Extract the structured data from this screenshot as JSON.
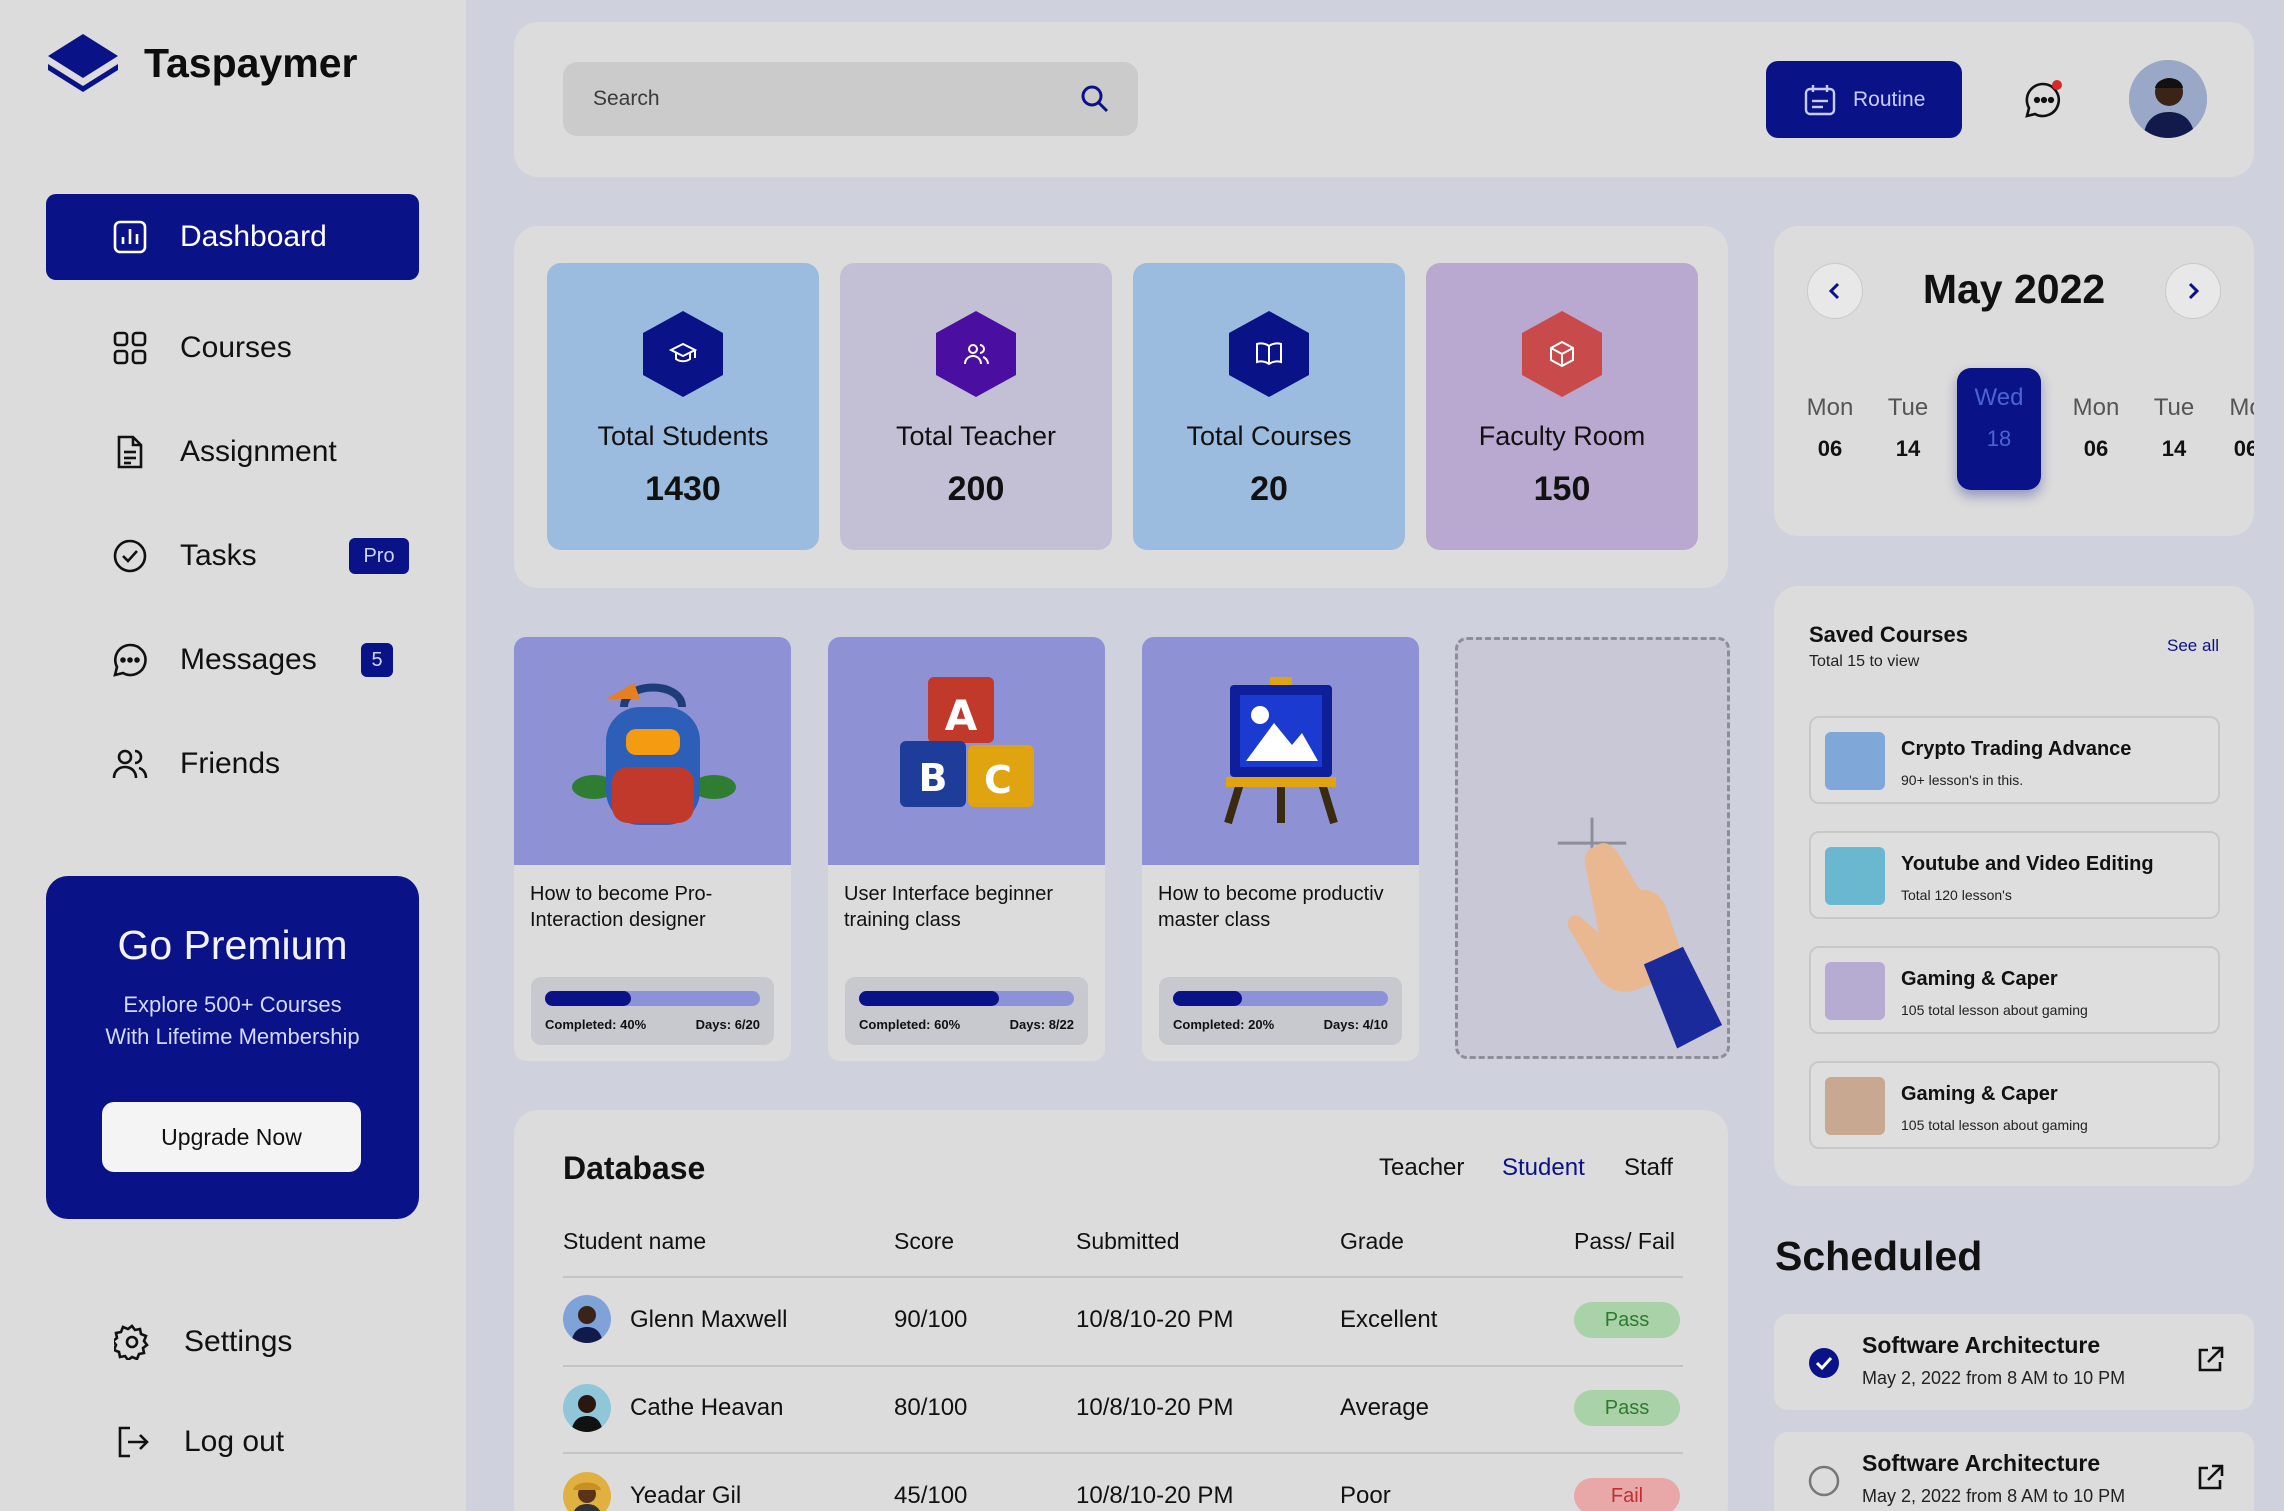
{
  "app": {
    "name": "Taspaymer"
  },
  "sidebar": {
    "nav": [
      {
        "label": "Dashboard",
        "active": true
      },
      {
        "label": "Courses"
      },
      {
        "label": "Assignment"
      },
      {
        "label": "Tasks",
        "badge": "Pro"
      },
      {
        "label": "Messages",
        "badge": "5"
      },
      {
        "label": "Friends"
      }
    ],
    "premium": {
      "title": "Go Premium",
      "line1": "Explore 500+ Courses",
      "line2": "With Lifetime Membership",
      "button": "Upgrade Now"
    },
    "settings": "Settings",
    "logout": "Log out"
  },
  "topbar": {
    "search_placeholder": "Search",
    "routine_label": "Routine"
  },
  "stats": [
    {
      "label": "Total Students",
      "value": "1430",
      "icon": "graduation-cap-icon",
      "color": "#0a1287"
    },
    {
      "label": "Total Teacher",
      "value": "200",
      "icon": "users-icon",
      "color": "#4a0fa0"
    },
    {
      "label": "Total Courses",
      "value": "20",
      "icon": "book-icon",
      "color": "#0a1287"
    },
    {
      "label": "Faculty Room",
      "value": "150",
      "icon": "cube-icon",
      "color": "#c94a4a"
    }
  ],
  "courses": [
    {
      "title": "How to become Pro-Interaction designer",
      "completed_label": "Completed:",
      "completed": "40%",
      "progress": 0.4,
      "days_label": "Days:",
      "days": "6/20"
    },
    {
      "title": "User Interface beginner training class",
      "completed_label": "Completed:",
      "completed": "60%",
      "progress": 0.65,
      "days_label": "Days:",
      "days": "8/22"
    },
    {
      "title": "How to become productiv master class",
      "completed_label": "Completed:",
      "completed": "20%",
      "progress": 0.32,
      "days_label": "Days:",
      "days": "4/10"
    }
  ],
  "database": {
    "title": "Database",
    "tabs": [
      "Teacher",
      "Student",
      "Staff"
    ],
    "active_tab": "Student",
    "columns": [
      "Student name",
      "Score",
      "Submitted",
      "Grade",
      "Pass/ Fail"
    ],
    "rows": [
      {
        "name": "Glenn Maxwell",
        "score": "90/100",
        "submitted": "10/8/10-20 PM",
        "grade": "Excellent",
        "status": "Pass"
      },
      {
        "name": "Cathe Heavan",
        "score": "80/100",
        "submitted": "10/8/10-20 PM",
        "grade": "Average",
        "status": "Pass"
      },
      {
        "name": "Yeadar Gil",
        "score": "45/100",
        "submitted": "10/8/10-20 PM",
        "grade": "Poor",
        "status": "Fail"
      }
    ]
  },
  "calendar": {
    "title": "May 2022",
    "days": [
      {
        "name": "Mon",
        "date": "06"
      },
      {
        "name": "Tue",
        "date": "14"
      },
      {
        "name": "Wed",
        "date": "18",
        "active": true
      },
      {
        "name": "Mon",
        "date": "06"
      },
      {
        "name": "Tue",
        "date": "14"
      },
      {
        "name": "Mo",
        "date": "06"
      }
    ]
  },
  "saved_courses": {
    "title": "Saved Courses",
    "subtitle": "Total 15 to view",
    "see_all": "See all",
    "items": [
      {
        "name": "Crypto Trading Advance",
        "desc": "90+ lesson's in this."
      },
      {
        "name": "Youtube and Video Editing",
        "desc": "Total 120 lesson's"
      },
      {
        "name": "Gaming & Caper",
        "desc": "105 total lesson about gaming"
      },
      {
        "name": "Gaming & Caper",
        "desc": "105 total lesson about gaming"
      }
    ]
  },
  "scheduled": {
    "title": "Scheduled",
    "items": [
      {
        "name": "Software Architecture",
        "time": "May 2, 2022 from 8 AM to 10 PM",
        "done": true
      },
      {
        "name": "Software Architecture",
        "time": "May 2, 2022 from 8 AM to 10 PM",
        "done": false
      }
    ]
  }
}
